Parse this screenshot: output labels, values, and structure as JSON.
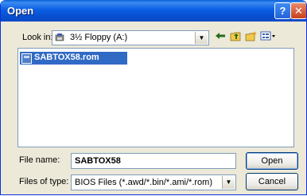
{
  "window": {
    "title": "Open",
    "help_glyph": "?",
    "close_glyph": "✕"
  },
  "look_in": {
    "label": "Look in:",
    "value": "3½ Floppy (A:)",
    "icon": "floppy-drive-icon"
  },
  "toolbar": {
    "back_icon": "back-arrow-icon",
    "up_icon": "up-folder-icon",
    "new_folder_icon": "new-folder-icon",
    "views_icon": "views-menu-icon"
  },
  "files": [
    {
      "name": "SABTOX58.rom",
      "selected": true,
      "icon": "rom-file-icon"
    }
  ],
  "file_name": {
    "label": "File name:",
    "value": "SABTOX58"
  },
  "file_type": {
    "label": "Files of type:",
    "value": "BIOS Files (*.awd/*.bin/*.ami/*.rom)"
  },
  "buttons": {
    "open": "Open",
    "cancel": "Cancel"
  },
  "colors": {
    "title_bar": "#0b5ee3",
    "selection": "#316ac5",
    "dialog_bg": "#ece9d8"
  }
}
